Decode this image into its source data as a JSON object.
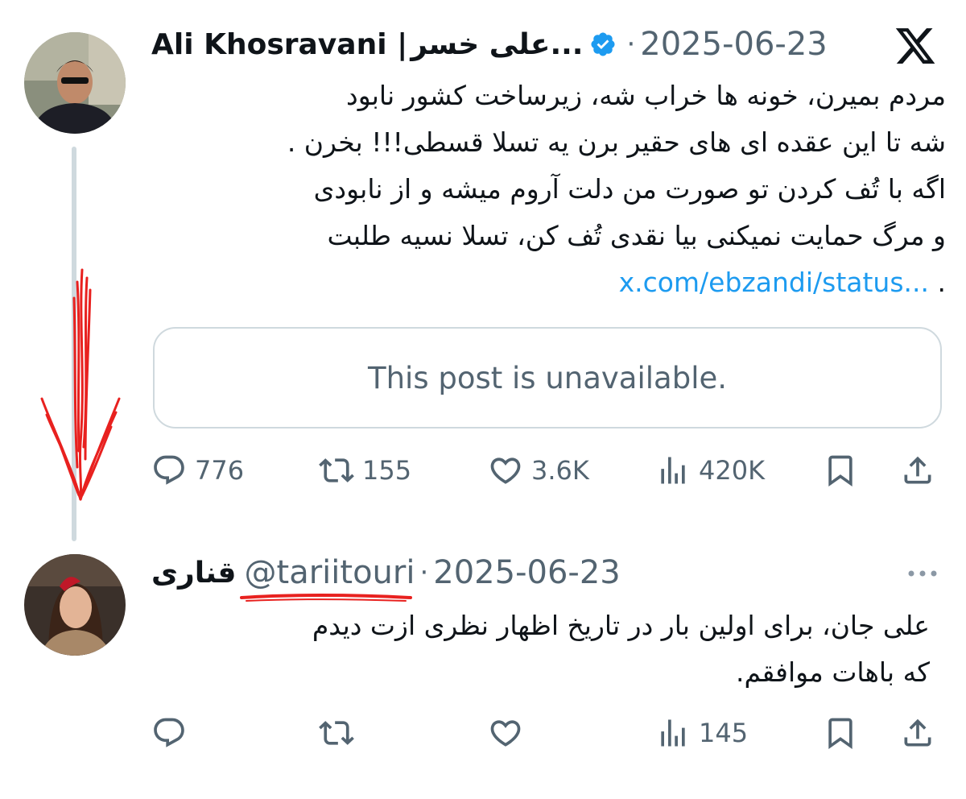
{
  "logo": {
    "icon": "x-logo-icon"
  },
  "original_post": {
    "author_name": "Ali Khosravani |",
    "author_name_fa": "علی خسر...",
    "verified": true,
    "date": "2025-06-23",
    "text_lines": [
      "مردم بمیرن، خونه ها خراب شه، زیرساخت کشور نابود",
      "شه تا این عقده ای های حقیر برن یه تسلا قسطی!!! بخرن .",
      "اگه با تُف کردن تو صورت من دلت آروم میشه و از نابودی",
      "و مرگ حمایت نمیکنی بیا نقدی  تُف کن، تسلا نسیه طلبت"
    ],
    "last_line_prefix": ".",
    "link_text": "x.com/ebzandi/status...",
    "quote_unavailable": "This post is unavailable.",
    "actions": {
      "replies": "776",
      "reposts": "155",
      "likes": "3.6K",
      "views": "420K"
    }
  },
  "reply_post": {
    "author_name": "قناری",
    "handle": "@tariitouri",
    "date": "2025-06-23",
    "text_lines": [
      "علی جان، برای اولین بار در تاریخ اظهار نظری ازت دیدم",
      "که باهات موافقم."
    ],
    "actions": {
      "views": "145"
    }
  },
  "colors": {
    "text": "#0f1419",
    "muted": "#536471",
    "link": "#1d9bf0",
    "verified": "#1d9bf0",
    "annotation": "#e8211f"
  }
}
